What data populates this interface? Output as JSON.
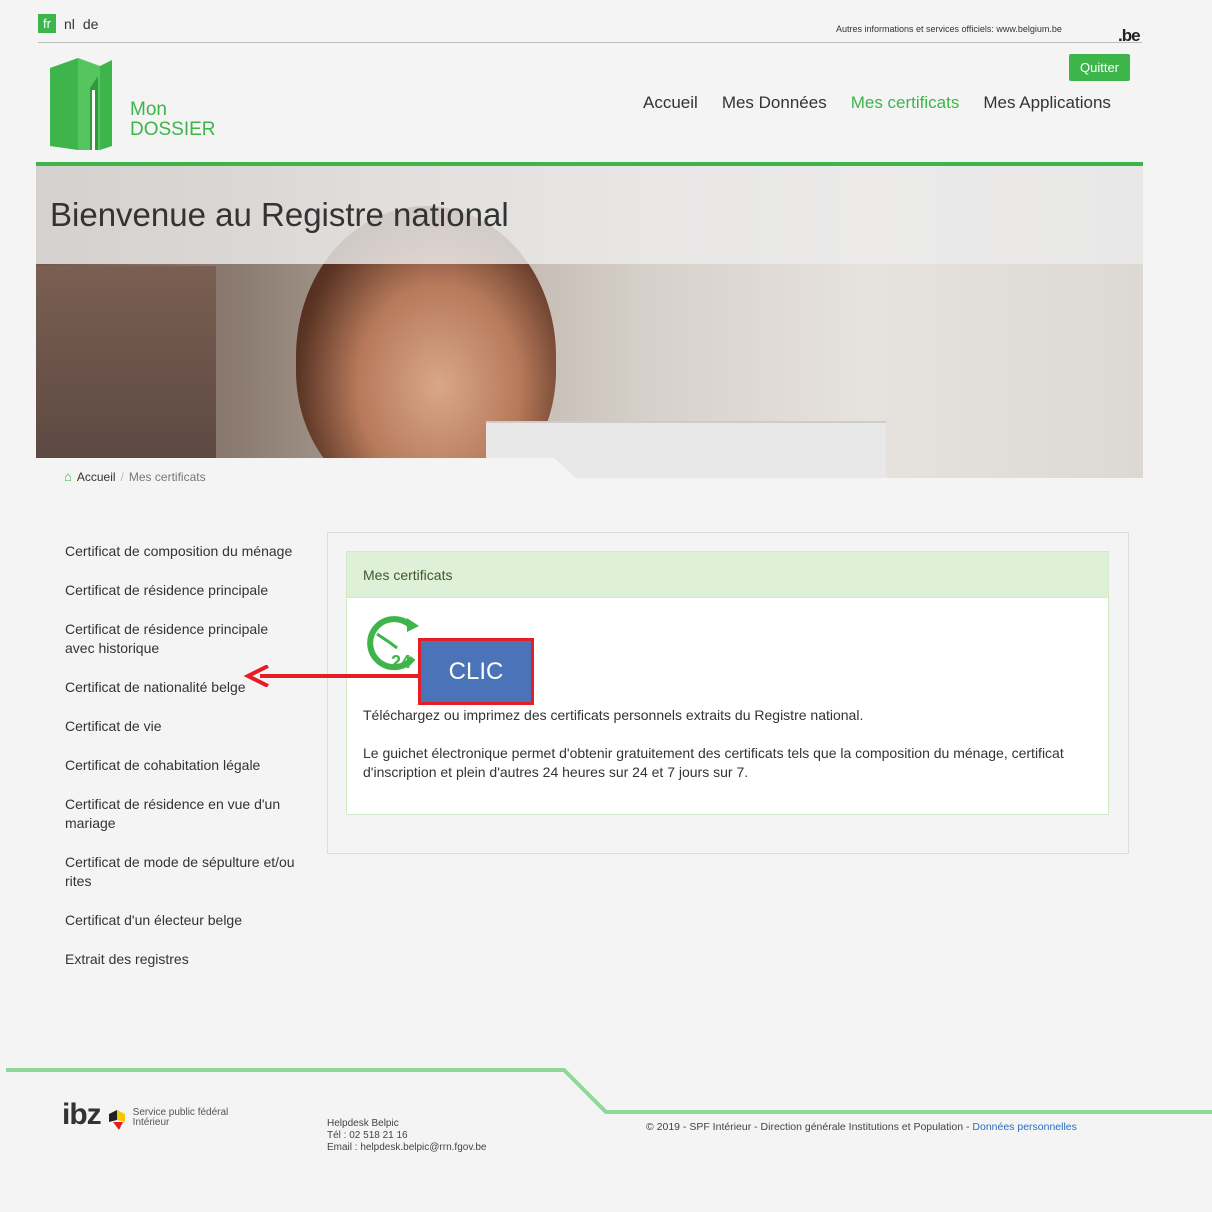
{
  "languages": [
    {
      "code": "fr",
      "active": true
    },
    {
      "code": "nl",
      "active": false
    },
    {
      "code": "de",
      "active": false
    }
  ],
  "official_info": "Autres informations et services officiels: www.belgium.be",
  "be_logo": ".be",
  "logo": {
    "line1": "Mon",
    "line2": "DOSSIER"
  },
  "quit_label": "Quitter",
  "nav": [
    "Accueil",
    "Mes Données",
    "Mes certificats",
    "Mes Applications"
  ],
  "nav_active": "Mes certificats",
  "hero_title": "Bienvenue au Registre national",
  "breadcrumb": {
    "home": "Accueil",
    "separator": "/",
    "current": "Mes certificats"
  },
  "sidebar": [
    "Certificat de composition du ménage",
    "Certificat de résidence principale",
    "Certificat de résidence principale avec historique",
    "Certificat de nationalité belge",
    "Certificat de vie",
    "Certificat de cohabitation légale",
    "Certificat de résidence en vue d'un mariage",
    "Certificat de mode de sépulture et/ou rites",
    "Certificat d'un électeur belge",
    "Extrait des registres"
  ],
  "panel": {
    "title": "Mes certificats",
    "clock_label": "24",
    "text1": "Téléchargez ou imprimez des certificats personnels extraits du Registre national.",
    "text2": "Le guichet électronique permet d'obtenir gratuitement des certificats tels que la composition du ménage, certificat d'inscription et plein d'autres 24 heures sur 24 et 7 jours sur 7."
  },
  "annotation": {
    "label": "CLIC"
  },
  "footer": {
    "ibz": "ibz",
    "ibz_sub1": "Service public fédéral",
    "ibz_sub2": "Intérieur",
    "helpdesk_title": "Helpdesk Belpic",
    "helpdesk_tel": "Tél : 02 518 21 16",
    "helpdesk_email": "Email : helpdesk.belpic@rrn.fgov.be",
    "copyright": "© 2019 - SPF Intérieur - Direction générale Institutions et Population - ",
    "privacy_link": "Données personnelles"
  },
  "colors": {
    "brand_green": "#3db54a",
    "annotation_red": "#e51e25",
    "annotation_blue": "#4a73b8"
  }
}
